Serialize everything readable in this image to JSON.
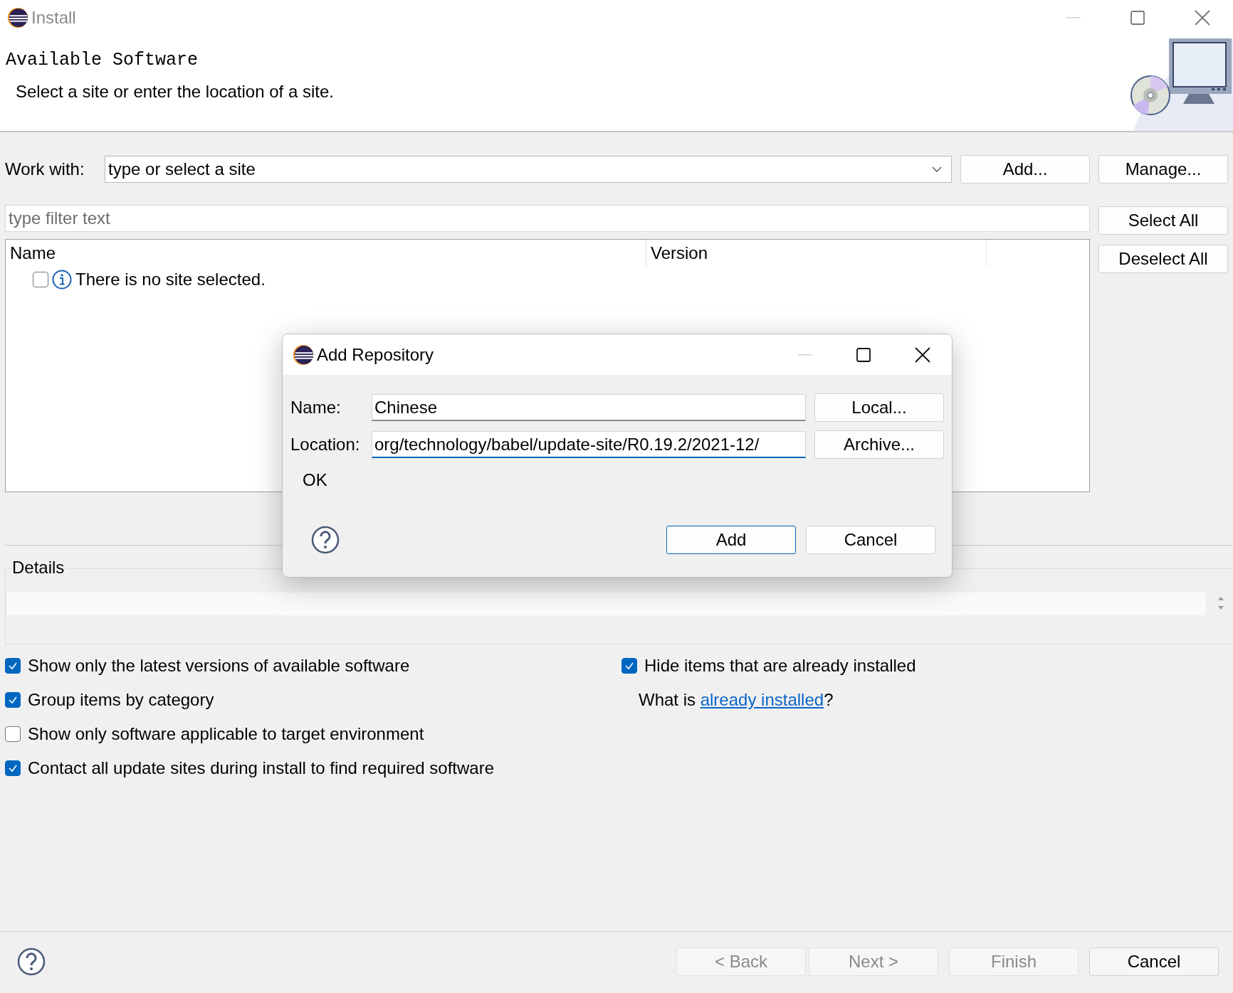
{
  "window": {
    "title": "Install"
  },
  "header": {
    "title": "Available Software",
    "description": "Select a site or enter the location of a site."
  },
  "work_with": {
    "label": "Work with:",
    "placeholder": "type or select a site",
    "buttons": [
      "Add...",
      "Manage..."
    ]
  },
  "filter": {
    "placeholder": "type filter text"
  },
  "selection_buttons": [
    "Select All",
    "Deselect All"
  ],
  "table": {
    "columns": [
      "Name",
      "Version"
    ],
    "rows": [
      {
        "name": "There is no site selected.",
        "checked": false
      }
    ]
  },
  "details": {
    "label": "Details"
  },
  "options": [
    {
      "label": "Show only the latest versions of available software",
      "checked": true
    },
    {
      "label": "Group items by category",
      "checked": true
    },
    {
      "label": "Show only software applicable to target environment",
      "checked": false
    },
    {
      "label": "Contact all update sites during install to find required software",
      "checked": true
    }
  ],
  "hide_installed": {
    "label": "Hide items that are already installed",
    "checked": true
  },
  "installed_info": {
    "prefix": "What is ",
    "link": "already installed",
    "suffix": "?"
  },
  "footer_buttons": [
    {
      "label": "< Back",
      "disabled": true
    },
    {
      "label": "Next >",
      "disabled": true
    },
    {
      "label": "Finish",
      "disabled": true
    },
    {
      "label": "Cancel",
      "disabled": false
    }
  ],
  "dialog": {
    "title": "Add Repository",
    "fields": [
      {
        "label": "Name:",
        "value": "Chinese",
        "button": "Local...",
        "focused": false
      },
      {
        "label": "Location:",
        "value": "org/technology/babel/update-site/R0.19.2/2021-12/",
        "button": "Archive...",
        "focused": true
      }
    ],
    "status": "OK",
    "buttons": [
      {
        "label": "Add",
        "default": true
      },
      {
        "label": "Cancel",
        "default": false
      }
    ]
  }
}
